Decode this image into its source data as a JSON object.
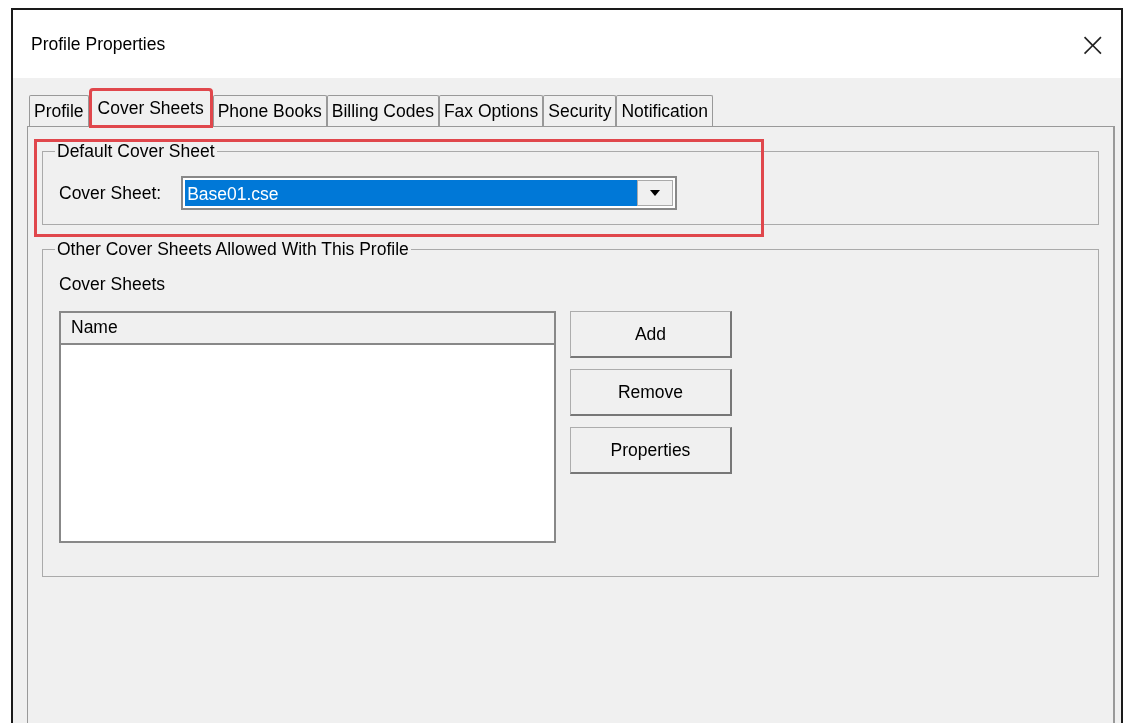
{
  "window": {
    "title": "Profile Properties",
    "close": "×"
  },
  "tabs": [
    {
      "label": "Profile",
      "selected": false,
      "highlighted": false
    },
    {
      "label": "Cover Sheets",
      "selected": true,
      "highlighted": true
    },
    {
      "label": "Phone Books",
      "selected": false,
      "highlighted": false
    },
    {
      "label": "Billing Codes",
      "selected": false,
      "highlighted": false
    },
    {
      "label": "Fax Options",
      "selected": false,
      "highlighted": false
    },
    {
      "label": "Security",
      "selected": false,
      "highlighted": false
    },
    {
      "label": "Notification",
      "selected": false,
      "highlighted": false
    }
  ],
  "default_group": {
    "title": "Default Cover Sheet",
    "highlighted": true,
    "label": "Cover Sheet:",
    "value": "Base01.cse"
  },
  "other_group": {
    "title": "Other Cover Sheets Allowed With This Profile",
    "list_label": "Cover Sheets",
    "columns": [
      "Name"
    ],
    "buttons": [
      "Add",
      "Remove",
      "Properties"
    ]
  }
}
